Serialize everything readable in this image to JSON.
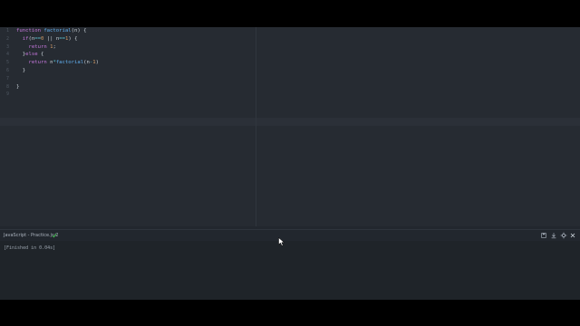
{
  "editor": {
    "line_numbers": [
      "1",
      "2",
      "3",
      "4",
      "5",
      "6",
      "7",
      "8",
      "9"
    ],
    "lines": [
      [
        {
          "t": "function ",
          "c": "kw"
        },
        {
          "t": "factorial",
          "c": "fn"
        },
        {
          "t": "(n) {",
          "c": "pl"
        }
      ],
      [
        {
          "t": "  ",
          "c": "pl"
        },
        {
          "t": "if",
          "c": "kw"
        },
        {
          "t": "(n",
          "c": "pl"
        },
        {
          "t": "==",
          "c": "op"
        },
        {
          "t": "0",
          "c": "num"
        },
        {
          "t": " || n",
          "c": "pl"
        },
        {
          "t": "==",
          "c": "op"
        },
        {
          "t": "1",
          "c": "num"
        },
        {
          "t": ") {",
          "c": "pl"
        }
      ],
      [
        {
          "t": "    ",
          "c": "pl"
        },
        {
          "t": "return ",
          "c": "kw"
        },
        {
          "t": "1",
          "c": "num"
        },
        {
          "t": ";",
          "c": "pl"
        }
      ],
      [
        {
          "t": "  }",
          "c": "pl"
        },
        {
          "t": "else",
          "c": "kw"
        },
        {
          "t": " {",
          "c": "pl"
        }
      ],
      [
        {
          "t": "    ",
          "c": "pl"
        },
        {
          "t": "return ",
          "c": "kw"
        },
        {
          "t": "n",
          "c": "pl"
        },
        {
          "t": "*",
          "c": "op"
        },
        {
          "t": "factorial",
          "c": "fn"
        },
        {
          "t": "(n",
          "c": "pl"
        },
        {
          "t": "-",
          "c": "op"
        },
        {
          "t": "1",
          "c": "num"
        },
        {
          "t": ")",
          "c": "pl"
        }
      ],
      [
        {
          "t": "  }",
          "c": "pl"
        }
      ],
      [
        {
          "t": "",
          "c": "pl"
        }
      ],
      [
        {
          "t": "}",
          "c": "pl"
        }
      ],
      [
        {
          "t": "",
          "c": "pl"
        }
      ]
    ]
  },
  "panel": {
    "title": "JavaScript - Practice.js:2",
    "status_icon": "check-icon",
    "buttons": [
      "save-icon",
      "download-icon",
      "pin-icon",
      "close-icon"
    ]
  },
  "output": {
    "text": "[Finished in 0.04s]"
  },
  "colors": {
    "background": "#22272e",
    "keyword": "#c678dd",
    "function": "#61afef",
    "number": "#d19a66",
    "operator": "#56b6c2",
    "success": "#3fb950"
  }
}
